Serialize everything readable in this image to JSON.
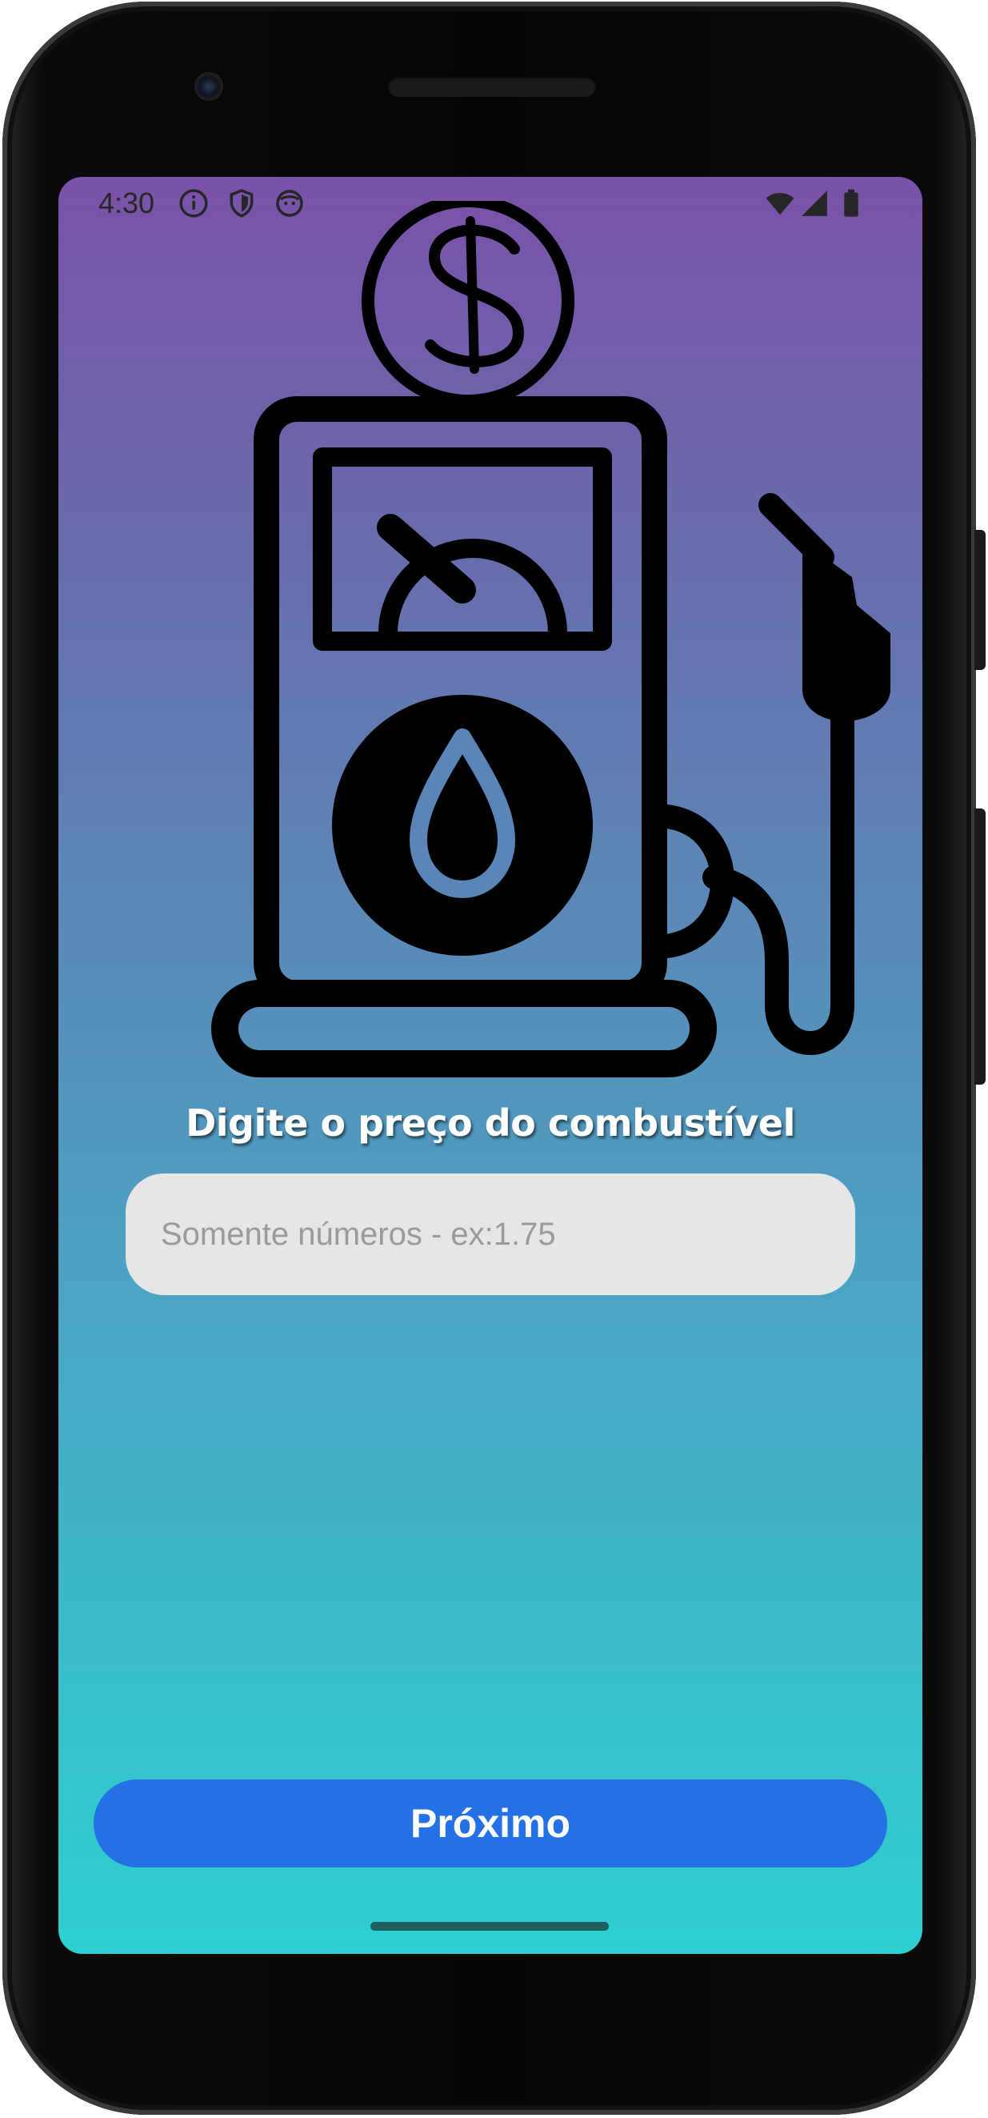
{
  "status_bar": {
    "time": "4:30",
    "left_icons": [
      "info-icon",
      "shield-icon",
      "face-icon"
    ],
    "right_icons": [
      "wifi-icon",
      "signal-icon",
      "battery-icon"
    ]
  },
  "illustration": {
    "icon": "gas-pump-with-dollar-coin-icon"
  },
  "form": {
    "label": "Digite o preço do combustível",
    "price_placeholder": "Somente números - ex:1.75",
    "price_value": ""
  },
  "actions": {
    "next_label": "Próximo"
  },
  "colors": {
    "gradient_top": "#7a52a9",
    "gradient_bottom": "#2ecfd0",
    "button": "#2471e6",
    "field": "#e6e6e6"
  }
}
